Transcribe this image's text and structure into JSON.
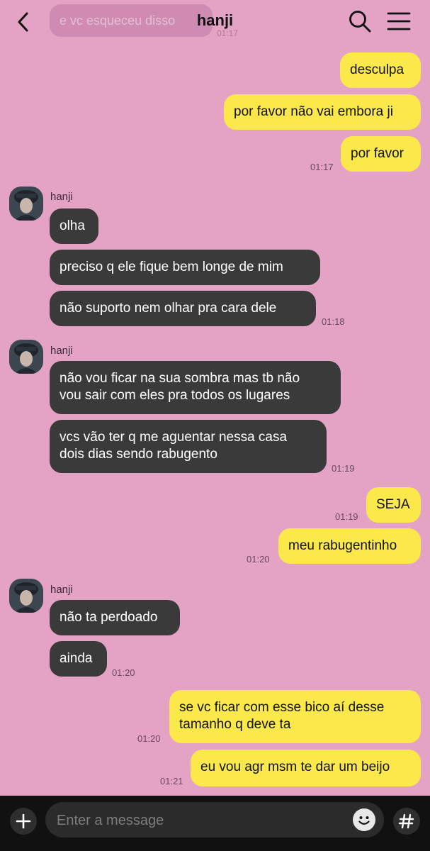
{
  "header": {
    "title": "hanji",
    "ghost_message": "e vc esqueceu disso",
    "ghost_time": "01:17"
  },
  "sender_name": "hanji",
  "messages": [
    {
      "side": "out",
      "text": "desculpa"
    },
    {
      "side": "out",
      "text": "por favor não vai embora ji"
    },
    {
      "side": "out",
      "text": "por favor",
      "time": "01:17"
    },
    {
      "side": "in",
      "text": "olha"
    },
    {
      "side": "in",
      "text": "preciso q ele fique bem longe de mim"
    },
    {
      "side": "in",
      "text": "não suporto nem olhar pra cara dele",
      "time": "01:18"
    },
    {
      "side": "in",
      "lines": [
        "não vou ficar na sua sombra mas tb não",
        "vou sair com eles pra todos os lugares"
      ]
    },
    {
      "side": "in",
      "lines": [
        "vcs vão ter q me aguentar nessa casa",
        "dois dias sendo rabugento"
      ],
      "time": "01:19"
    },
    {
      "side": "out",
      "text": "SEJA",
      "time": "01:19"
    },
    {
      "side": "out",
      "text": "meu rabugentinho",
      "time": "01:20"
    },
    {
      "side": "in",
      "text": "não ta perdoado"
    },
    {
      "side": "in",
      "text": "ainda",
      "time": "01:20"
    },
    {
      "side": "out",
      "lines": [
        "se vc ficar com esse bico aí desse",
        "tamanho q deve ta"
      ],
      "time": "01:20"
    },
    {
      "side": "out",
      "text": "eu vou agr msm te dar um beijo",
      "time": "01:21"
    }
  ],
  "input": {
    "placeholder": "Enter a message",
    "value": ""
  },
  "icons": {
    "back": "chevron-left-icon",
    "search": "search-icon",
    "menu": "hamburger-menu-icon",
    "attach": "plus-icon",
    "emoji": "emoji-icon",
    "hashtag": "hashtag-icon"
  },
  "colors": {
    "background": "#e4a2c5",
    "outgoing_bubble": "#fbe84a",
    "incoming_bubble": "#3a3a3a",
    "input_bar": "#111111"
  }
}
